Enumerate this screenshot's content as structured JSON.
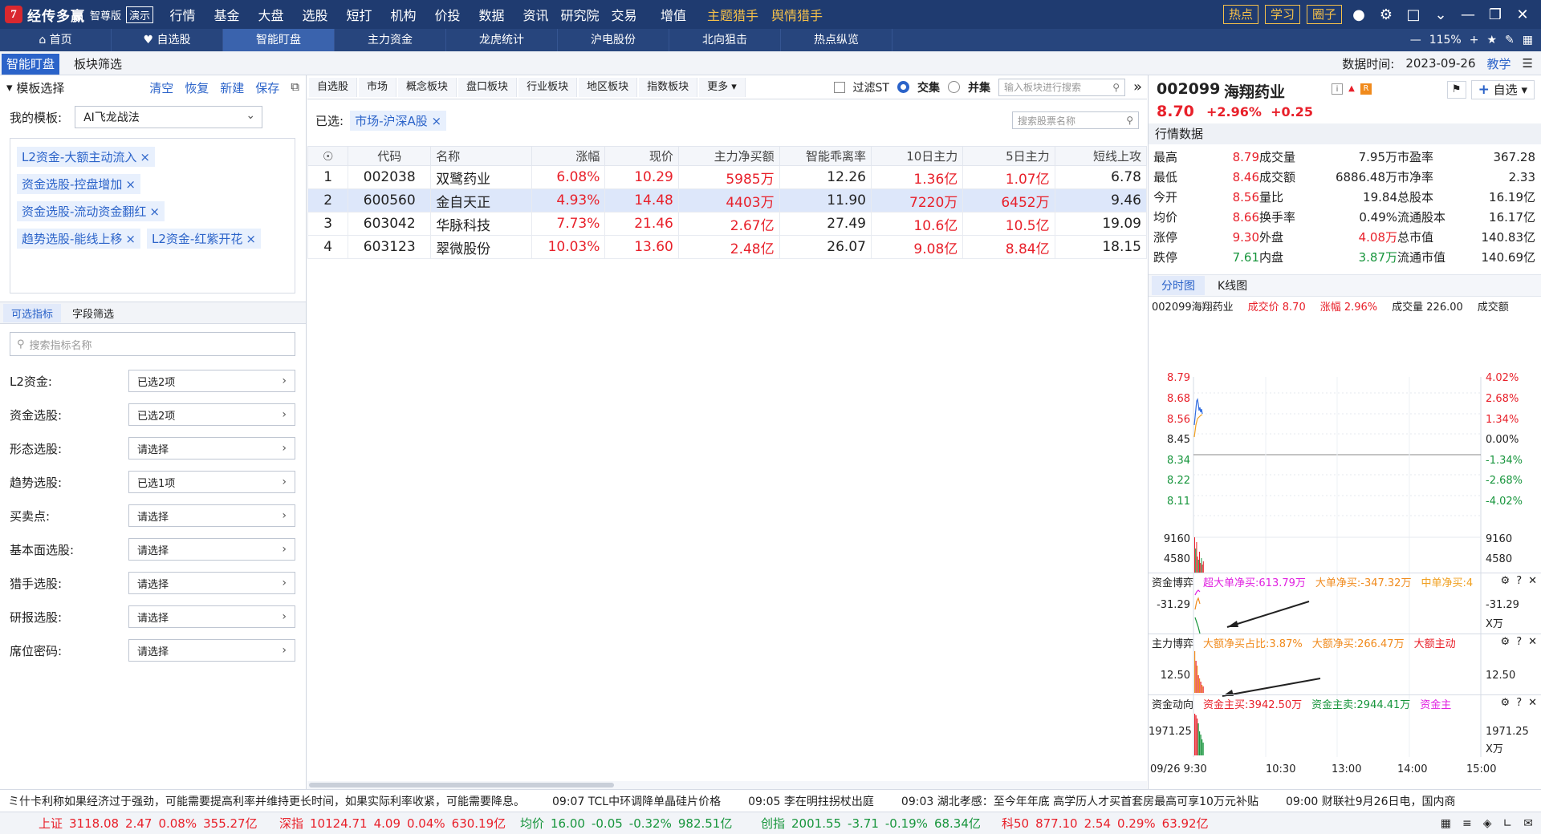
{
  "app": {
    "logo_text": "经传多赢",
    "edition": "智尊版",
    "demo": "演示",
    "menu": [
      "行情",
      "基金",
      "大盘",
      "选股",
      "短打",
      "机构",
      "价投",
      "数据",
      "资讯",
      "研究院",
      "交易",
      "增值",
      "主题猎手",
      "舆情猎手"
    ],
    "top_buttons": [
      "热点",
      "学习",
      "圈子"
    ]
  },
  "nav": {
    "tabs": [
      "首页",
      "自选股",
      "智能盯盘",
      "主力资金",
      "龙虎统计",
      "沪电股份",
      "北向狙击",
      "热点纵览"
    ],
    "active_tab": "智能盯盘",
    "zoom": "115%"
  },
  "subbar": {
    "tabs": [
      "智能盯盘",
      "板块筛选"
    ],
    "data_time_label": "数据时间:",
    "data_time": "2023-09-26",
    "teach": "教学"
  },
  "left": {
    "title": "模板选择",
    "actions": [
      "清空",
      "恢复",
      "新建",
      "保存"
    ],
    "my_template_label": "我的模板:",
    "my_template_value": "AI飞龙战法",
    "tags": [
      "L2资金-大额主动流入",
      "资金选股-控盘增加",
      "资金选股-流动资金翻红",
      "趋势选股-能线上移",
      "L2资金-红紫开花"
    ],
    "tabs": [
      "可选指标",
      "字段筛选"
    ],
    "search_placeholder": "搜索指标名称",
    "indicators": [
      {
        "label": "L2资金:",
        "value": "已选2项"
      },
      {
        "label": "资金选股:",
        "value": "已选2项"
      },
      {
        "label": "形态选股:",
        "value": "请选择"
      },
      {
        "label": "趋势选股:",
        "value": "已选1项"
      },
      {
        "label": "买卖点:",
        "value": "请选择"
      },
      {
        "label": "基本面选股:",
        "value": "请选择"
      },
      {
        "label": "猎手选股:",
        "value": "请选择"
      },
      {
        "label": "研报选股:",
        "value": "请选择"
      },
      {
        "label": "席位密码:",
        "value": "请选择"
      }
    ]
  },
  "center": {
    "toolbar": [
      "自选股",
      "市场",
      "概念板块",
      "盘口板块",
      "行业板块",
      "地区板块",
      "指数板块",
      "更多"
    ],
    "filter_st": "过滤ST",
    "mode_jiao": "交集",
    "mode_bing": "并集",
    "block_search_placeholder": "输入板块进行搜索",
    "selected_label": "已选:",
    "selected_chip": "市场-沪深A股",
    "stock_search_placeholder": "搜索股票名称",
    "columns": [
      "代码",
      "名称",
      "涨幅",
      "现价",
      "主力净买额",
      "智能乖离率",
      "10日主力",
      "5日主力",
      "短线上攻"
    ],
    "rows": [
      {
        "no": "1",
        "code": "002038",
        "name": "双鹭药业",
        "chg": "6.08%",
        "price": "10.29",
        "net": "5985万",
        "bias": "12.26",
        "m10": "1.36亿",
        "m5": "1.07亿",
        "attack": "6.78"
      },
      {
        "no": "2",
        "code": "600560",
        "name": "金自天正",
        "chg": "4.93%",
        "price": "14.48",
        "net": "4403万",
        "bias": "11.90",
        "m10": "7220万",
        "m5": "6452万",
        "attack": "9.46"
      },
      {
        "no": "3",
        "code": "603042",
        "name": "华脉科技",
        "chg": "7.73%",
        "price": "21.46",
        "net": "2.67亿",
        "bias": "27.49",
        "m10": "10.6亿",
        "m5": "10.5亿",
        "attack": "19.09"
      },
      {
        "no": "4",
        "code": "603123",
        "name": "翠微股份",
        "chg": "10.03%",
        "price": "13.60",
        "net": "2.48亿",
        "bias": "26.07",
        "m10": "9.08亿",
        "m5": "8.84亿",
        "attack": "18.15"
      }
    ]
  },
  "stock": {
    "code": "002099",
    "name": "海翔药业",
    "price": "8.70",
    "chg_pct": "+2.96%",
    "chg": "+0.25",
    "add_fav": "自选",
    "section": "行情数据",
    "quote": [
      [
        "最高",
        "8.79",
        "成交量",
        "7.95万",
        "市盈率",
        "367.28"
      ],
      [
        "最低",
        "8.46",
        "成交额",
        "6886.48万",
        "市净率",
        "2.33"
      ],
      [
        "今开",
        "8.56",
        "量比",
        "19.84",
        "总股本",
        "16.19亿"
      ],
      [
        "均价",
        "8.66",
        "换手率",
        "0.49%",
        "流通股本",
        "16.17亿"
      ],
      [
        "涨停",
        "9.30",
        "外盘",
        "4.08万",
        "总市值",
        "140.83亿"
      ],
      [
        "跌停",
        "7.61",
        "内盘",
        "3.87万",
        "流通市值",
        "140.69亿"
      ]
    ],
    "chart_tabs": [
      "分时图",
      "K线图"
    ],
    "chart_head": [
      "002099海翔药业",
      "成交价 8.70",
      "涨幅 2.96%",
      "成交量 226.00",
      "成交额"
    ],
    "price_ticks": [
      "8.79",
      "8.68",
      "8.56",
      "8.45",
      "8.34",
      "8.22",
      "8.11"
    ],
    "pct_ticks": [
      "4.02%",
      "2.68%",
      "1.34%",
      "0.00%",
      "-1.34%",
      "-2.68%",
      "-4.02%"
    ],
    "vol_ticks": [
      "9160",
      "4580"
    ],
    "panel1": {
      "title": "资金博弈",
      "items": [
        "超大单净买:613.79万",
        "大单净买:-347.32万",
        "中单净买:4"
      ],
      "tick": "-31.29",
      "unit": "X万"
    },
    "panel2": {
      "title": "主力博弈",
      "items": [
        "大额净买占比:3.87%",
        "大额净买:266.47万",
        "大额主动"
      ],
      "tick": "12.50"
    },
    "panel3": {
      "title": "资金动向",
      "items": [
        "资金主买:3942.50万",
        "资金主卖:2944.41万",
        "资金主"
      ],
      "tick": "1971.25",
      "unit": "X万"
    },
    "time_ticks": [
      "09/26 9:30",
      "10:30",
      "13:00",
      "14:00",
      "15:00"
    ]
  },
  "ticker": [
    "ミ什卡利称如果经济过于强劲，可能需要提高利率并维持更长时间，如果实际利率收紧，可能需要降息。",
    "09:07 TCL中环调降单晶硅片价格",
    "09:05 李在明拄拐杖出庭",
    "09:03 湖北孝感：至今年年底 高学历人才买首套房最高可享10万元补贴",
    "09:00 财联社9月26日电，国内商"
  ],
  "indices": [
    {
      "name": "上证",
      "val": "3118.08",
      "chg": "2.47",
      "pct": "0.08%",
      "amt": "355.27亿",
      "dir": "up"
    },
    {
      "name": "深指",
      "val": "10124.71",
      "chg": "4.09",
      "pct": "0.04%",
      "amt": "630.19亿",
      "dir": "up"
    },
    {
      "name": "均价",
      "val": "16.00",
      "chg": "-0.05",
      "pct": "-0.32%",
      "amt": "982.51亿",
      "dir": "down"
    },
    {
      "name": "创指",
      "val": "2001.55",
      "chg": "-3.71",
      "pct": "-0.19%",
      "amt": "68.34亿",
      "dir": "down"
    },
    {
      "name": "科50",
      "val": "877.10",
      "chg": "2.54",
      "pct": "0.29%",
      "amt": "63.92亿",
      "dir": "up"
    }
  ],
  "colors": {
    "up": "#e8202a",
    "down": "#17953c",
    "accent": "#2b63c9",
    "topbar": "#1f3b70"
  }
}
